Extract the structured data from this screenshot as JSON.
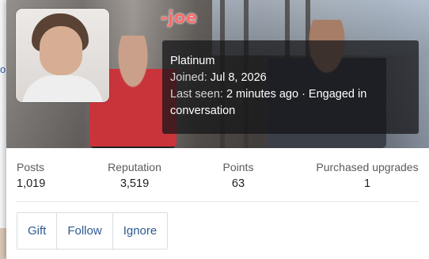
{
  "page": {
    "left_link_text": "o"
  },
  "profile": {
    "username": "-joe",
    "rank": "Platinum",
    "joined_label": "Joined:",
    "joined_value": "Jul 8, 2026",
    "last_seen_label": "Last seen:",
    "last_seen_value": "2 minutes ago · Engaged in",
    "last_seen_value_cont": "conversation",
    "username_color": "#ff6a6a"
  },
  "stats": [
    {
      "label": "Posts",
      "value": "1,019"
    },
    {
      "label": "Reputation",
      "value": "3,519"
    },
    {
      "label": "Points",
      "value": "63"
    },
    {
      "label": "Purchased upgrades",
      "value": "1"
    }
  ],
  "actions": {
    "gift_label": "Gift",
    "follow_label": "Follow",
    "ignore_label": "Ignore"
  },
  "colors": {
    "link": "#2c5a8f",
    "info_box_bg": "rgba(20,20,22,0.72)"
  }
}
